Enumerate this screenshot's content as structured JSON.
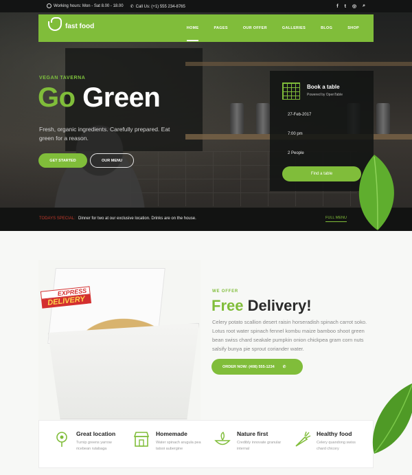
{
  "topbar": {
    "hours": "Working hours: Mon - Sat 8.00 - 18.00",
    "phone": "Call Us: (+1) 555 234-8765",
    "social": [
      "f",
      "t",
      "◎",
      "⌕"
    ]
  },
  "nav": {
    "logo": "fast food",
    "items": [
      "HOME",
      "PAGES",
      "OUR OFFER",
      "GALLERIES",
      "BLOG",
      "SHOP"
    ]
  },
  "hero": {
    "subtitle": "VEGAN TAVERNA",
    "title_highlight": "Go",
    "title_rest": " Green",
    "tagline": "Fresh, organic ingredients. Carefully prepared. Eat green for a reason.",
    "btn_start": "GET STARTED",
    "btn_menu": "OUR MENU"
  },
  "booking": {
    "title": "Book a table",
    "powered": "Powered by OpenTable",
    "date": "27-Feb-2017",
    "time": "7:00 pm",
    "people": "2 People",
    "find": "Find a table"
  },
  "announce": {
    "label": "TODAYS SPECIAL:",
    "text": "Dinner for two at our exclusive location. Drinks are on the house.",
    "link": "FULL MENU"
  },
  "offer": {
    "badge_top": "EXPRESS",
    "badge_bottom": "DELIVERY",
    "eyebrow": "WE OFFER",
    "head_highlight": "Free",
    "head_rest": " Delivery!",
    "description": "Celery potato scallion desert raisin horseradish spinach carrot soko. Lotus root water spinach fennel kombu maize bamboo shoot green bean swiss chard seakale pumpkin onion chickpea gram corn nuts salsify bunya pie sprout coriander water.",
    "order_label": "ORDER NOW: (408) 555-1234",
    "order_icon": "phone-icon"
  },
  "features": [
    {
      "title": "Great location",
      "text": "Turnip greens yarrow ricebean rutabaga",
      "icon": "location-icon"
    },
    {
      "title": "Homemade",
      "text": "Water spinach arugula pea tatsoi aubergine",
      "icon": "shop-icon"
    },
    {
      "title": "Nature first",
      "text": "Credibly innovate granular internal",
      "icon": "leaf-bowl-icon"
    },
    {
      "title": "Healthy food",
      "text": "Celery quandong swiss chard chicory",
      "icon": "carrot-icon"
    }
  ],
  "colors": {
    "accent": "#80bd3a",
    "dark": "#121312",
    "special": "#c0392b"
  }
}
